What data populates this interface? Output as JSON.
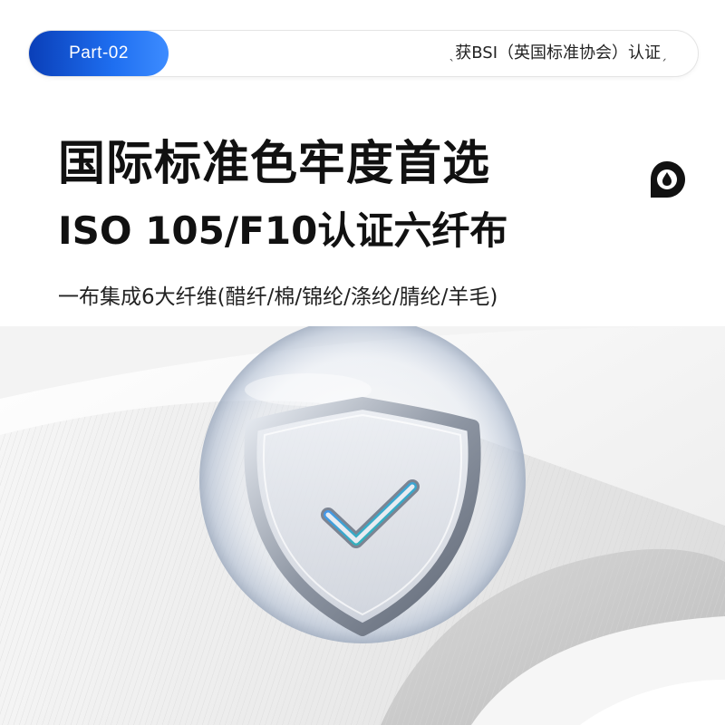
{
  "header": {
    "part_label": "Part-02",
    "certification_text": "获BSI（英国标准协会）认证",
    "deco_left": "ˎ",
    "deco_right": "ˏ"
  },
  "main": {
    "headline": "国际标准色牢度首选",
    "subheadline": "ISO 105/F10认证六纤布",
    "fibers_line": "一布集成6大纤维(醋纤/棉/锦纶/涤纶/腈纶/羊毛)"
  },
  "icons": {
    "drop": "water-drop-icon",
    "shield": "shield-check-icon"
  },
  "colors": {
    "accent_start": "#0a3fb8",
    "accent_end": "#3d8cff",
    "text": "#111111"
  }
}
